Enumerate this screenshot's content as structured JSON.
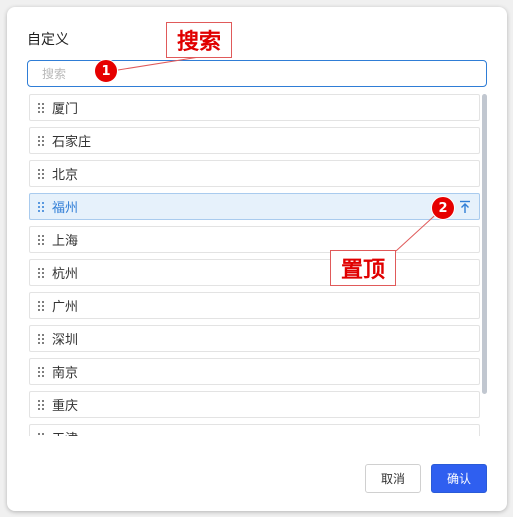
{
  "dialog": {
    "title": "自定义",
    "search": {
      "value": "",
      "placeholder": "搜索"
    },
    "cities": [
      {
        "label": "厦门"
      },
      {
        "label": "石家庄"
      },
      {
        "label": "北京"
      },
      {
        "label": "福州",
        "active": true
      },
      {
        "label": "上海"
      },
      {
        "label": "杭州"
      },
      {
        "label": "广州"
      },
      {
        "label": "深圳"
      },
      {
        "label": "南京"
      },
      {
        "label": "重庆"
      },
      {
        "label": "天津"
      }
    ],
    "buttons": {
      "cancel": "取消",
      "ok": "确认"
    }
  },
  "annotations": {
    "search": {
      "number": "1",
      "label": "搜索"
    },
    "pin": {
      "number": "2",
      "label": "置顶"
    }
  },
  "icons": {
    "drag": "drag-handle-icon",
    "pin": "pin-to-top-icon"
  },
  "colors": {
    "accent": "#2f7dd6",
    "primary_button": "#2f5ff0",
    "active_row_bg": "#e6f1fb",
    "annotation_red": "#e60000"
  }
}
